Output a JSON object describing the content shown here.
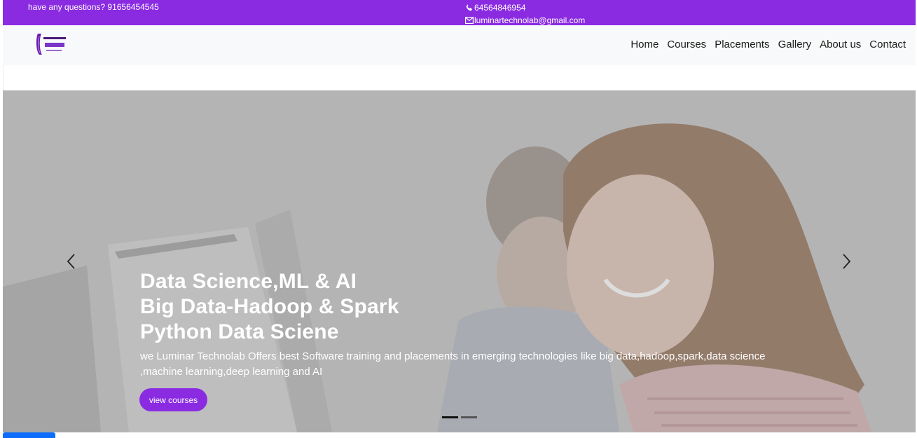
{
  "topbar": {
    "questions": "have any questions? 91656454545",
    "phone": "64564846954",
    "email": "luminartechnolab@gmail.com"
  },
  "logo": {
    "text": "LUMINAR TECHNOLAB"
  },
  "nav": {
    "items": [
      "Home",
      "Courses",
      "Placements",
      "Gallery",
      "About us",
      "Contact"
    ]
  },
  "hero": {
    "headings": [
      "Data Science,ML & AI",
      "Big Data-Hadoop & Spark",
      "Python Data Sciene"
    ],
    "description_line1": "we Luminar Technolab Offers best Software training and placements in emerging technologies like big data,hadoop,spark,data science",
    "description_line2": ",machine learning,deep learning and AI",
    "button": "view courses",
    "slide_count": 2,
    "active_slide": 1
  },
  "colors": {
    "brand": "#8a2be2",
    "navbar_bg": "#f8f9fa",
    "accent_tab": "#0d6efd"
  },
  "icons": {
    "phone": "phone-icon",
    "email": "envelope-icon",
    "prev": "chevron-left-icon",
    "next": "chevron-right-icon"
  }
}
